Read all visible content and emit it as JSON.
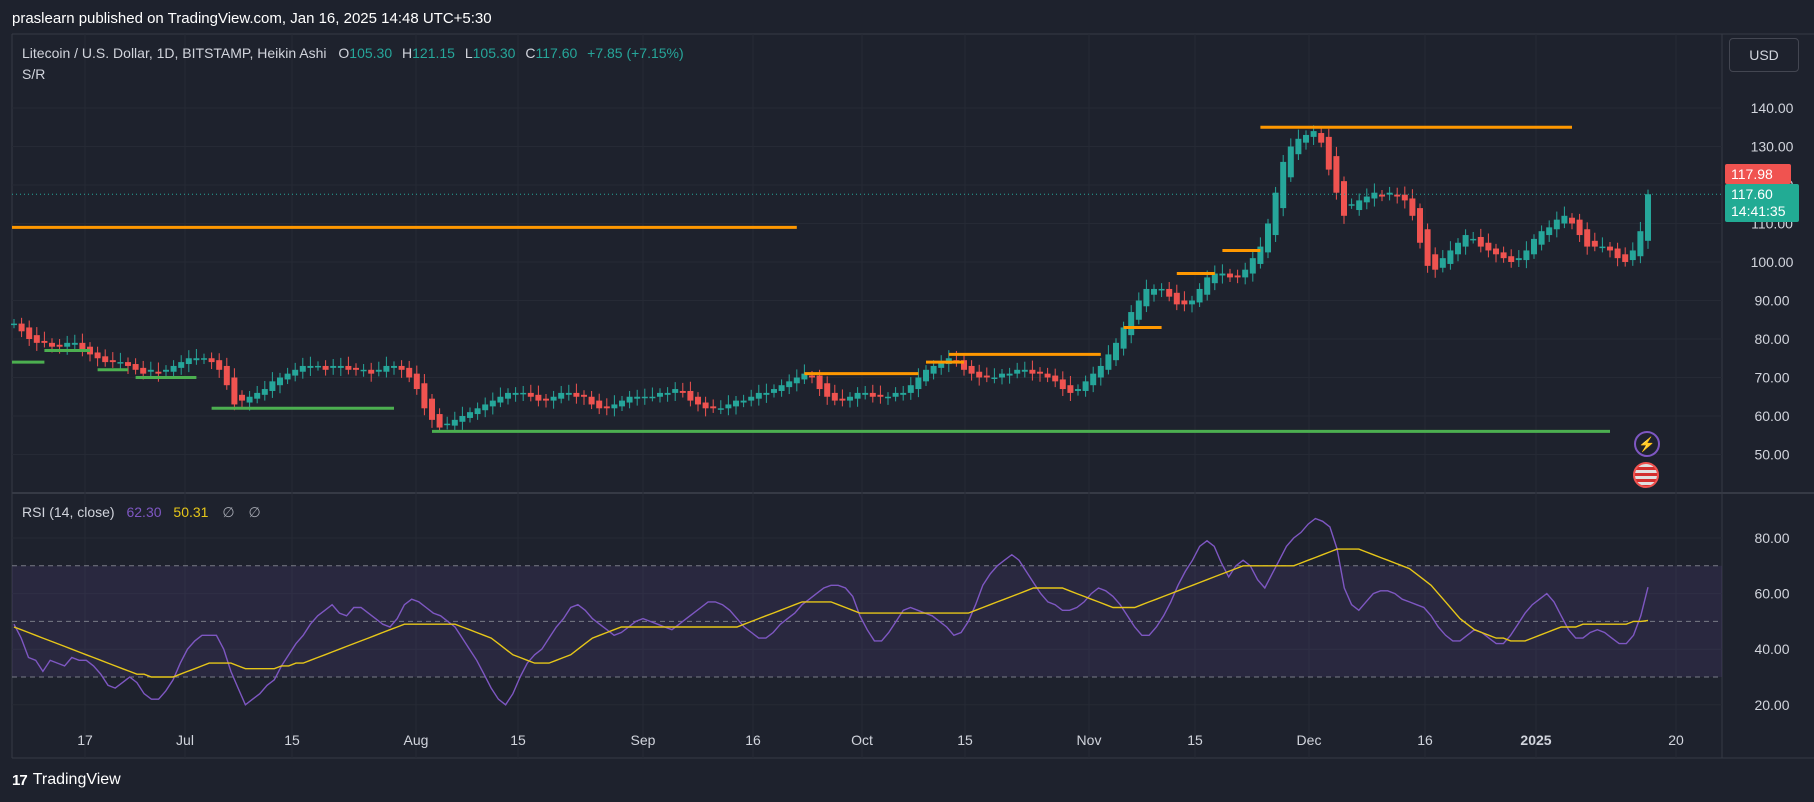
{
  "publish_line": "praslearn published on TradingView.com, Jan 16, 2025 14:48 UTC+5:30",
  "legend": {
    "symbol": "Litecoin / U.S. Dollar, 1D, BITSTAMP, Heikin Ashi",
    "o_label": "O",
    "o": "105.30",
    "h_label": "H",
    "h": "121.15",
    "l_label": "L",
    "l": "105.30",
    "c_label": "C",
    "c": "117.60",
    "change": "+7.85 (+7.15%)",
    "indicator": "S/R"
  },
  "rsi_legend": {
    "label": "RSI (14, close)",
    "rsi": "62.30",
    "ma": "50.31",
    "null1": "∅",
    "null2": "∅"
  },
  "currency_button": "USD",
  "price_tags": {
    "high": "117.98",
    "last": "117.60",
    "countdown": "14:41:35"
  },
  "brand": "TradingView",
  "colors": {
    "up": "#26a69a",
    "down": "#ef5350",
    "resistance": "#ff9800",
    "support": "#4caf50",
    "rsi": "#7e57c2",
    "rsi_ma": "#e6c619"
  },
  "chart_data": [
    {
      "type": "candlestick",
      "title": "Litecoin / U.S. Dollar, 1D, BITSTAMP, Heikin Ashi",
      "ylim": [
        42,
        150
      ],
      "y_ticks": [
        "140.00",
        "130.00",
        "120.00",
        "110.00",
        "100.00",
        "90.00",
        "80.00",
        "70.00",
        "60.00",
        "50.00"
      ],
      "x_ticks": [
        "17",
        "Jul",
        "15",
        "Aug",
        "15",
        "Sep",
        "16",
        "Oct",
        "15",
        "Nov",
        "15",
        "Dec",
        "16",
        "2025",
        "20"
      ],
      "closes": [
        84,
        82,
        80,
        79,
        79,
        78,
        78,
        79,
        79,
        77,
        76,
        75,
        74,
        74,
        74,
        73,
        72,
        71,
        72,
        71,
        72,
        73,
        74,
        75,
        75,
        75,
        74,
        72,
        68,
        63,
        64,
        65,
        66,
        67,
        69,
        70,
        71,
        72,
        73,
        73,
        73,
        72,
        73,
        73,
        72,
        72,
        72,
        71,
        72,
        73,
        73,
        72,
        70,
        67,
        62,
        59,
        57,
        58,
        59,
        60,
        61,
        62,
        63,
        64,
        65,
        66,
        66,
        66,
        65,
        64,
        64,
        65,
        66,
        66,
        65,
        65,
        63,
        62,
        62,
        63,
        64,
        65,
        65,
        65,
        65,
        66,
        66,
        67,
        66,
        64,
        63,
        62,
        62,
        62,
        63,
        64,
        64,
        65,
        66,
        66,
        67,
        68,
        69,
        70,
        71,
        70,
        67,
        65,
        64,
        64,
        65,
        66,
        66,
        65,
        65,
        65,
        66,
        66,
        68,
        70,
        72,
        73,
        74,
        75,
        74,
        72,
        71,
        70,
        70,
        70,
        71,
        71,
        72,
        72,
        71,
        71,
        70,
        69,
        67,
        66,
        67,
        69,
        71,
        73,
        76,
        79,
        83,
        87,
        90,
        93,
        93,
        93,
        91,
        89,
        89,
        90,
        93,
        96,
        97,
        97,
        96,
        96,
        98,
        101,
        104,
        110,
        118,
        126,
        130,
        132,
        133,
        134,
        131,
        124,
        118,
        112,
        115,
        116,
        117,
        118,
        117,
        118,
        117,
        116,
        112,
        105,
        99,
        98,
        101,
        103,
        105,
        107,
        106,
        104,
        103,
        102,
        101,
        100,
        101,
        103,
        106,
        108,
        109,
        111,
        112,
        110,
        107,
        104,
        104,
        104,
        103,
        101,
        100,
        103,
        108,
        117.6
      ],
      "support_lines": [
        74,
        77,
        72,
        70,
        62,
        56
      ],
      "resistance_lines": [
        109,
        71,
        74,
        76,
        83,
        97,
        103,
        135
      ],
      "last_price": 117.6,
      "high_marker": 117.98
    },
    {
      "type": "line",
      "title": "RSI (14, close)",
      "ylim": [
        12,
        95
      ],
      "y_ticks": [
        "80.00",
        "60.00",
        "40.00",
        "20.00"
      ],
      "bands": [
        30,
        50,
        70
      ],
      "series": [
        {
          "name": "RSI",
          "values": [
            49,
            44,
            37,
            36,
            32,
            36,
            35,
            34,
            37,
            36,
            36,
            34,
            31,
            27,
            26,
            28,
            30,
            28,
            24,
            22,
            22,
            25,
            29,
            35,
            40,
            43,
            45,
            45,
            45,
            40,
            32,
            26,
            20,
            22,
            24,
            27,
            29,
            34,
            38,
            42,
            45,
            49,
            52,
            54,
            56,
            53,
            52,
            55,
            55,
            53,
            51,
            49,
            48,
            51,
            56,
            58,
            57,
            55,
            53,
            52,
            50,
            48,
            44,
            40,
            36,
            31,
            26,
            22,
            20,
            24,
            30,
            35,
            38,
            40,
            44,
            48,
            51,
            55,
            56,
            54,
            51,
            49,
            47,
            45,
            46,
            48,
            50,
            51,
            50,
            49,
            48,
            47,
            49,
            51,
            53,
            55,
            57,
            57,
            56,
            54,
            51,
            48,
            46,
            44,
            44,
            46,
            49,
            51,
            53,
            56,
            58,
            60,
            62,
            63,
            63,
            62,
            59,
            52,
            47,
            43,
            43,
            46,
            50,
            54,
            55,
            54,
            53,
            52,
            50,
            48,
            45,
            46,
            50,
            56,
            63,
            67,
            70,
            72,
            74,
            72,
            68,
            64,
            60,
            57,
            56,
            54,
            54,
            55,
            57,
            60,
            62,
            61,
            59,
            56,
            52,
            48,
            45,
            45,
            48,
            52,
            57,
            63,
            68,
            72,
            77,
            79,
            77,
            71,
            66,
            70,
            72,
            70,
            65,
            62,
            67,
            72,
            77,
            80,
            82,
            85,
            87,
            86,
            84,
            76,
            62,
            56,
            54,
            57,
            60,
            61,
            61,
            60,
            58,
            57,
            56,
            55,
            52,
            48,
            45,
            43,
            43,
            45,
            47,
            46,
            44,
            42,
            42,
            45,
            49,
            53,
            56,
            58,
            60,
            57,
            52,
            47,
            44,
            44,
            46,
            47,
            46,
            44,
            42,
            42,
            45,
            52,
            62.3
          ]
        },
        {
          "name": "MA",
          "values": [
            48,
            47,
            46,
            45,
            44,
            43,
            42,
            41,
            40,
            39,
            38,
            37,
            36,
            35,
            34,
            33,
            32,
            31,
            31,
            30,
            30,
            30,
            30,
            31,
            32,
            33,
            34,
            35,
            35,
            35,
            35,
            34,
            33,
            33,
            33,
            33,
            33,
            34,
            34,
            35,
            35,
            36,
            37,
            38,
            39,
            40,
            41,
            42,
            43,
            44,
            45,
            46,
            47,
            48,
            49,
            49,
            49,
            49,
            49,
            49,
            49,
            49,
            48,
            47,
            46,
            45,
            44,
            42,
            40,
            38,
            37,
            36,
            35,
            35,
            35,
            36,
            37,
            38,
            40,
            42,
            44,
            45,
            46,
            47,
            48,
            48,
            48,
            48,
            48,
            48,
            48,
            48,
            48,
            48,
            48,
            48,
            48,
            48,
            48,
            48,
            48,
            49,
            50,
            51,
            52,
            53,
            54,
            55,
            56,
            57,
            57,
            57,
            57,
            57,
            56,
            55,
            54,
            53,
            53,
            53,
            53,
            53,
            53,
            53,
            53,
            53,
            53,
            53,
            53,
            53,
            53,
            53,
            53,
            54,
            55,
            56,
            57,
            58,
            59,
            60,
            61,
            62,
            62,
            62,
            62,
            62,
            61,
            60,
            59,
            58,
            57,
            56,
            55,
            55,
            55,
            55,
            56,
            57,
            58,
            59,
            60,
            61,
            62,
            63,
            64,
            65,
            66,
            67,
            68,
            69,
            70,
            70,
            70,
            70,
            70,
            70,
            70,
            70,
            71,
            72,
            73,
            74,
            75,
            76,
            76,
            76,
            76,
            75,
            74,
            73,
            72,
            71,
            70,
            69,
            67,
            65,
            63,
            60,
            57,
            54,
            51,
            49,
            47,
            46,
            45,
            44,
            44,
            43,
            43,
            43,
            44,
            45,
            46,
            47,
            48,
            48,
            48,
            49,
            49,
            49,
            49,
            49,
            49,
            49,
            50,
            50,
            50.31
          ]
        }
      ]
    }
  ]
}
